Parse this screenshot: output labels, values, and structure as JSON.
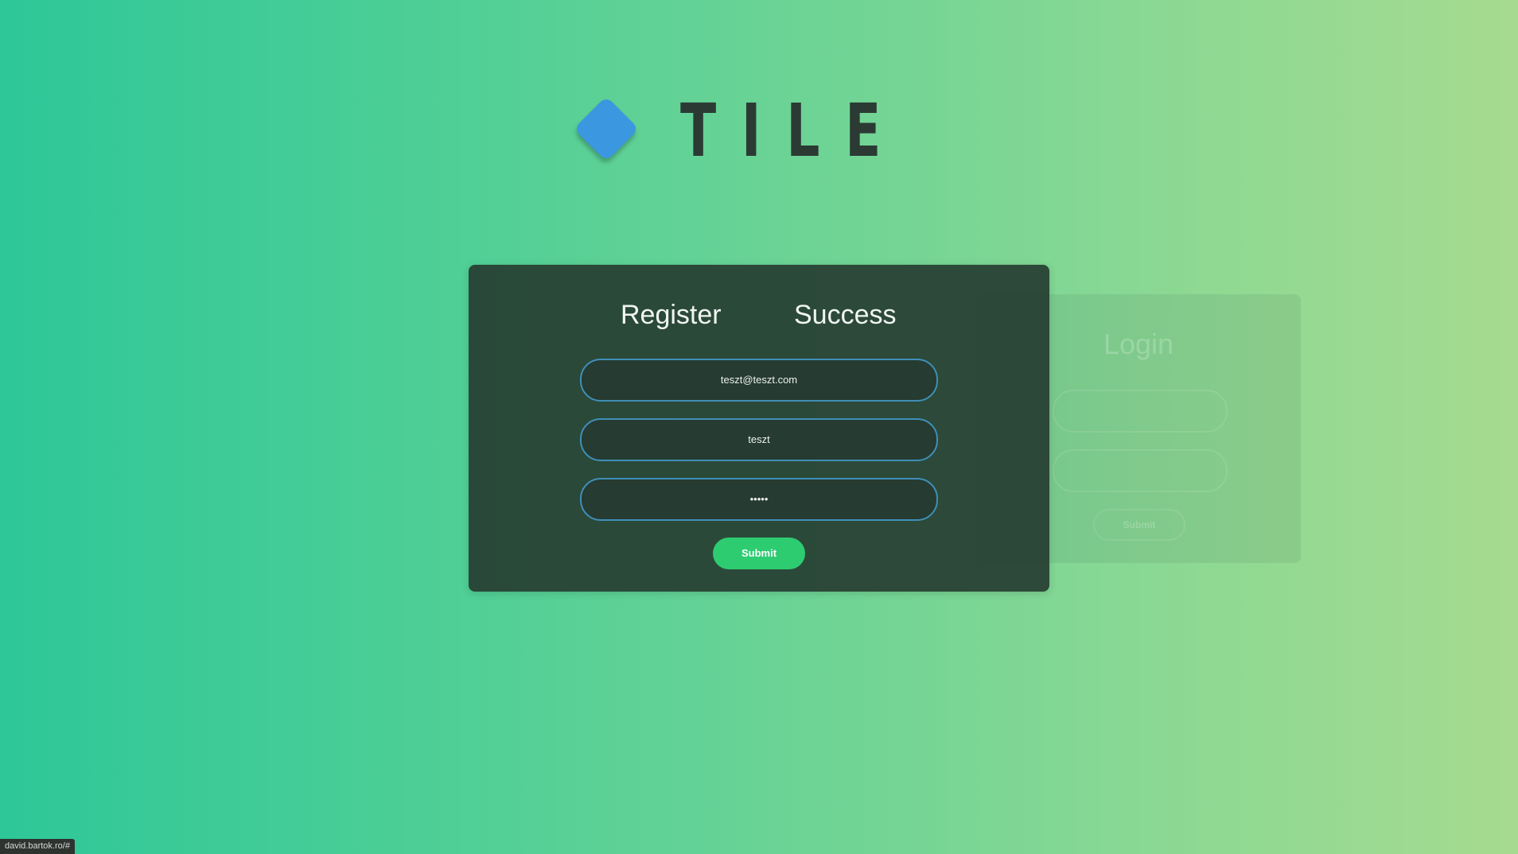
{
  "logo": {
    "text": "TILE",
    "icon": "diamond-icon",
    "icon_color": "#3b97df"
  },
  "register_card": {
    "tabs": [
      {
        "label": "Register"
      },
      {
        "label": "Success"
      }
    ],
    "fields": [
      {
        "value": "teszt@teszt.com"
      },
      {
        "value": "teszt"
      },
      {
        "value": "•••••"
      }
    ],
    "submit_label": "Submit"
  },
  "login_card": {
    "title": "Login",
    "submit_label": "Submit"
  },
  "status_bar": {
    "url": "david.bartok.ro/#"
  },
  "colors": {
    "background_start": "#2ec798",
    "background_end": "#a6da90",
    "card": "#263d31",
    "field_border": "#3f8fb8",
    "submit": "#2ecc71"
  }
}
